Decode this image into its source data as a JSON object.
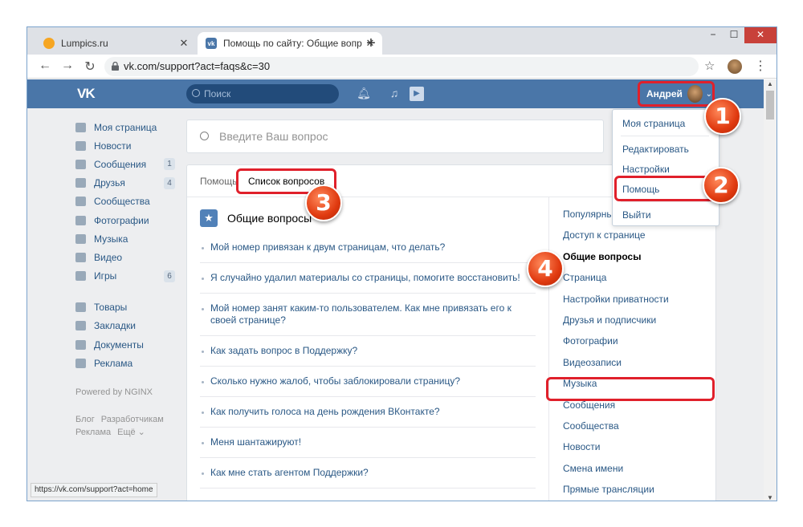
{
  "browser": {
    "tabs": [
      {
        "label": "Lumpics.ru"
      },
      {
        "label": "Помощь по сайту: Общие вопр"
      }
    ],
    "url": "vk.com/support?act=faqs&c=30",
    "status_url": "https://vk.com/support?act=home"
  },
  "vk": {
    "logo": "VK",
    "search_placeholder": "Поиск",
    "user_name": "Андрей",
    "left_nav": [
      {
        "label": "Моя страница",
        "icon": "home-icon",
        "count": ""
      },
      {
        "label": "Новости",
        "icon": "news-icon",
        "count": ""
      },
      {
        "label": "Сообщения",
        "icon": "message-icon",
        "count": "1"
      },
      {
        "label": "Друзья",
        "icon": "friends-icon",
        "count": "4"
      },
      {
        "label": "Сообщества",
        "icon": "groups-icon",
        "count": ""
      },
      {
        "label": "Фотографии",
        "icon": "camera-icon",
        "count": ""
      },
      {
        "label": "Музыка",
        "icon": "music-icon",
        "count": ""
      },
      {
        "label": "Видео",
        "icon": "video-icon",
        "count": ""
      },
      {
        "label": "Игры",
        "icon": "games-icon",
        "count": "6"
      },
      {
        "label": "Товары",
        "icon": "bag-icon",
        "count": ""
      },
      {
        "label": "Закладки",
        "icon": "star-icon",
        "count": ""
      },
      {
        "label": "Документы",
        "icon": "document-icon",
        "count": ""
      },
      {
        "label": "Реклама",
        "icon": "megaphone-icon",
        "count": ""
      }
    ],
    "powered": "Powered by NGINX",
    "footer_links": [
      "Блог",
      "Разработчикам",
      "Реклама",
      "Ещё ⌄"
    ],
    "question_placeholder": "Введите Ваш вопрос",
    "breadcrumb": {
      "home": "Помощь",
      "current": "Список вопросов"
    },
    "section_title": "Общие вопросы",
    "questions": [
      "Мой номер привязан к двум страницам, что делать?",
      "Я случайно удалил материалы со страницы, помогите восстановить!",
      "Мой номер занят каким-то пользователем. Как мне привязать его к своей странице?",
      "Как задать вопрос в Поддержку?",
      "Сколько нужно жалоб, чтобы заблокировали страницу?",
      "Как получить голоса на день рождения ВКонтакте?",
      "Меня шантажируют!",
      "Как мне стать агентом Поддержки?"
    ],
    "categories": [
      "Популярные",
      "Доступ к странице",
      "Общие вопросы",
      "Страница",
      "Настройки приватности",
      "Друзья и подписчики",
      "Фотографии",
      "Видеозаписи",
      "Музыка",
      "Сообщения",
      "Сообщества",
      "Новости",
      "Смена имени",
      "Прямые трансляции"
    ],
    "dropdown": [
      "Моя страница",
      "Редактировать",
      "Настройки",
      "Помощь",
      "Выйти"
    ]
  },
  "badges": [
    "1",
    "2",
    "3",
    "4"
  ],
  "colors": {
    "vk_blue": "#4a76a8",
    "highlight_red": "#e0202b",
    "link": "#2a5885"
  }
}
